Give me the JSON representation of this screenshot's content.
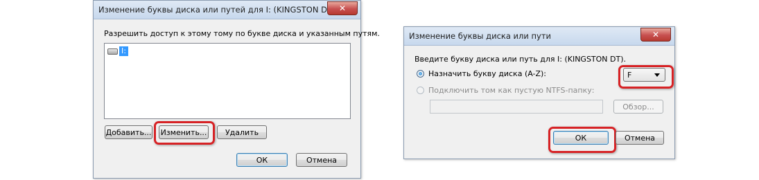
{
  "left_dialog": {
    "title": "Изменение буквы диска или путей для I: (KINGSTON DT)",
    "close_label": "✕",
    "description": "Разрешить доступ к этому тому по букве диска и указанным путям.",
    "list_items": [
      {
        "icon": "drive-icon",
        "label": "I:"
      }
    ],
    "buttons": {
      "add": "Добавить...",
      "change": "Изменить...",
      "remove": "Удалить",
      "ok": "ОК",
      "cancel": "Отмена"
    }
  },
  "right_dialog": {
    "title": "Изменение буквы диска или пути",
    "close_label": "✕",
    "description": "Введите букву диска или путь для I: (KINGSTON DT).",
    "option_assign": "Назначить букву диска (A-Z):",
    "option_mount": "Подключить том как пустую NTFS-папку:",
    "drive_letter": "F",
    "browse_button": "Обзор...",
    "ok": "ОК",
    "cancel": "Отмена"
  },
  "colors": {
    "highlight": "#d72225",
    "dialog_bg": "#f0f0f0",
    "selection": "#3399ff"
  }
}
